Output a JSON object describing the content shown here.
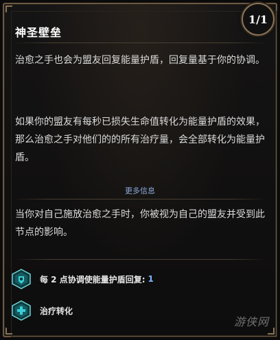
{
  "tooltip": {
    "title": "神圣壁垒",
    "page_indicator": "1/1",
    "paragraphs": [
      "治愈之手也会为盟友回复能量护盾，回复量基于你的协调。",
      "如果你的盟友有每秒已损失生命值转化为能量护盾的效果，那么治愈之手对他们的的所有治疗量，会全部转化为能量护盾。"
    ],
    "more_info": "更多信息",
    "extra_paragraph": "当你对自己施放治愈之手时，你被视为自己的盟友并受到此节点的影响。",
    "modifiers": [
      {
        "icon": "shield-fist-icon",
        "label": "每 2 点协调使能量护盾回复:",
        "value": "1"
      },
      {
        "icon": "healing-conversion-icon",
        "label": "治疗转化",
        "value": ""
      }
    ]
  },
  "watermark": "游侠网",
  "colors": {
    "accent_value": "#7fb4ff",
    "more_info": "#8aa8d8",
    "frame": "#6c5a43",
    "hex_icon": "#27b0b8"
  }
}
